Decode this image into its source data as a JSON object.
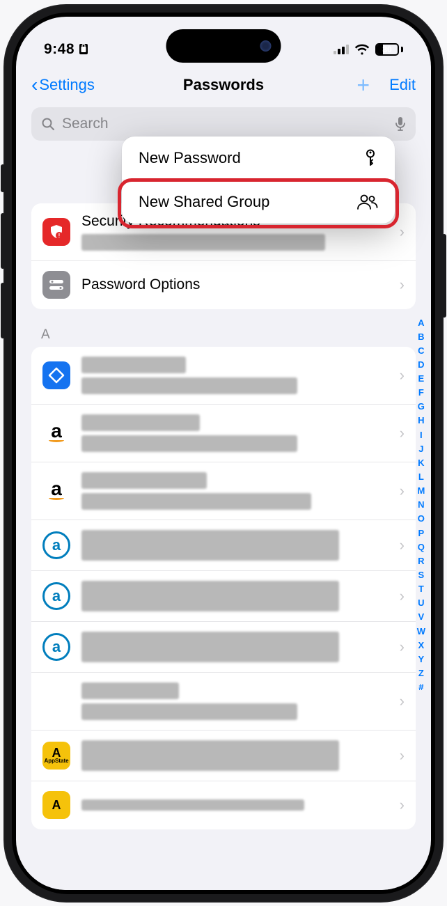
{
  "status": {
    "time": "9:48",
    "battery": "30"
  },
  "nav": {
    "back": "Settings",
    "title": "Passwords",
    "edit": "Edit"
  },
  "search": {
    "placeholder": "Search"
  },
  "popup": {
    "new_password": "New Password",
    "new_group": "New Shared Group"
  },
  "rows": {
    "security": "Security Recommendations",
    "options": "Password Options"
  },
  "section_a": "A",
  "appstate": "AppState",
  "alpha": [
    "A",
    "B",
    "C",
    "D",
    "E",
    "F",
    "G",
    "H",
    "I",
    "J",
    "K",
    "L",
    "M",
    "N",
    "O",
    "P",
    "Q",
    "R",
    "S",
    "T",
    "U",
    "V",
    "W",
    "X",
    "Y",
    "Z",
    "#"
  ]
}
